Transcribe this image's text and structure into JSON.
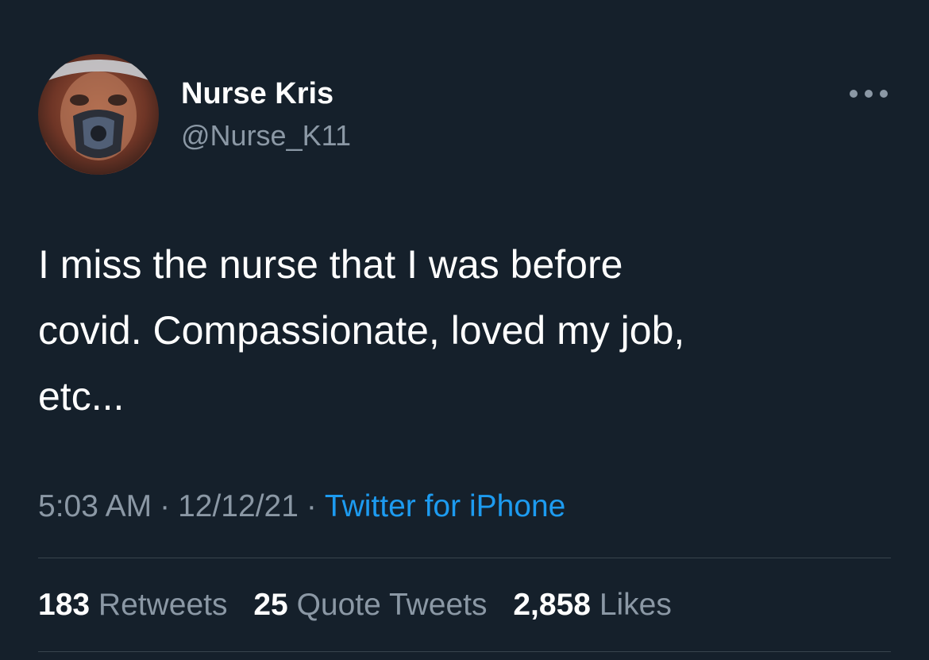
{
  "colors": {
    "background": "#15202b",
    "text_primary": "#ffffff",
    "text_secondary": "#8b98a5",
    "link": "#1d9bf0",
    "divider": "#38444d"
  },
  "author": {
    "display_name": "Nurse Kris",
    "handle": "@Nurse_K11",
    "avatar_icon": "profile-photo-face-shield-mask"
  },
  "more_icon": "ellipsis-icon",
  "tweet": {
    "text": "I miss the nurse that I was before\ncovid. Compassionate, loved my job,\netc..."
  },
  "meta": {
    "time": "5:03 AM",
    "separator": "·",
    "date": "12/12/21",
    "source": "Twitter for iPhone"
  },
  "stats": {
    "retweets_count": "183",
    "retweets_label": "Retweets",
    "quotes_count": "25",
    "quotes_label": "Quote Tweets",
    "likes_count": "2,858",
    "likes_label": "Likes"
  }
}
